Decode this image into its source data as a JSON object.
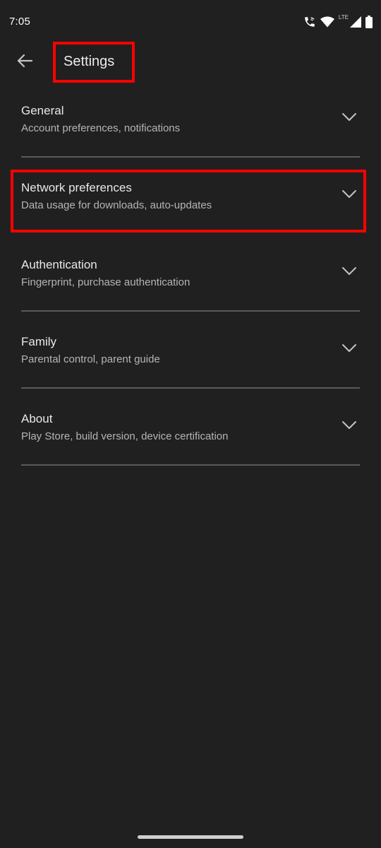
{
  "status_bar": {
    "time": "7:05",
    "network_label": "LTE",
    "icons": [
      "wifi-calling-icon",
      "wifi-icon",
      "cell-signal-icon",
      "battery-icon"
    ]
  },
  "app_bar": {
    "back_icon": "arrow-back-icon",
    "title": "Settings"
  },
  "settings": {
    "items": [
      {
        "title": "General",
        "subtitle": "Account preferences, notifications",
        "icon": "chevron-down-icon"
      },
      {
        "title": "Network preferences",
        "subtitle": "Data usage for downloads, auto-updates",
        "icon": "chevron-down-icon",
        "highlighted": true
      },
      {
        "title": "Authentication",
        "subtitle": "Fingerprint, purchase authentication",
        "icon": "chevron-down-icon"
      },
      {
        "title": "Family",
        "subtitle": "Parental control, parent guide",
        "icon": "chevron-down-icon"
      },
      {
        "title": "About",
        "subtitle": "Play Store, build version, device certification",
        "icon": "chevron-down-icon"
      }
    ]
  },
  "colors": {
    "background": "#202020",
    "highlight": "#ff0000",
    "divider": "#5a5a5a",
    "primary_text": "#e8e8e8",
    "secondary_text": "#b5b5b5"
  }
}
